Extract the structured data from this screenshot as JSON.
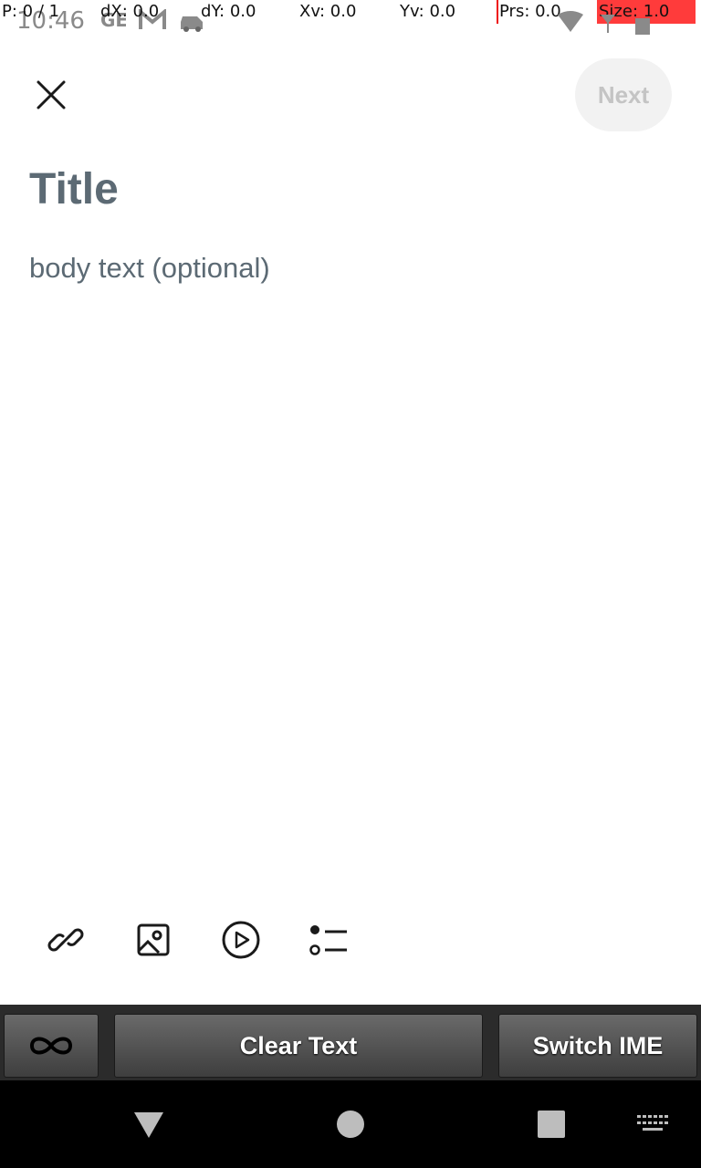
{
  "status_bar": {
    "time": "10:46",
    "overlay": {
      "p": "P: 0 / 1",
      "dx": "dX: 0.0",
      "dy": "dY: 0.0",
      "xv": "Xv: 0.0",
      "yv": "Yv: 0.0",
      "prs": "Prs: 0.0",
      "size": "Size: 1.0"
    },
    "icons": [
      "ge-logo-icon",
      "gmail-icon",
      "car-icon",
      "wifi-icon",
      "signal-icon",
      "battery-icon"
    ]
  },
  "top_bar": {
    "close_icon": "close-icon",
    "next_label": "Next"
  },
  "editor": {
    "title_placeholder": "Title",
    "body_placeholder": "body text (optional)"
  },
  "toolbar": {
    "icons": [
      "link-icon",
      "image-icon",
      "video-icon",
      "list-icon"
    ]
  },
  "ime_bar": {
    "clear_label": "Clear Text",
    "switch_label": "Switch IME"
  },
  "nav_bar": {
    "icons": [
      "back-icon",
      "home-icon",
      "recents-icon",
      "keyboard-icon"
    ]
  },
  "colors": {
    "placeholder": "#5c6a74",
    "next_bg": "#f2f2f2",
    "next_text": "#c4c4c4",
    "overlay_red": "#ff3b3b"
  }
}
